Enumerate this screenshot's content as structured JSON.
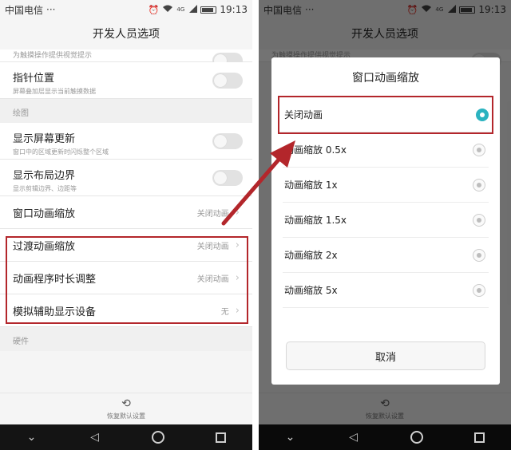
{
  "status": {
    "carrier": "中国电信",
    "dots": "···",
    "network": "4G",
    "time": "19:13"
  },
  "screen_title": "开发人员选项",
  "left_list": {
    "clipped_subtitle": "为触摸操作提供视觉提示",
    "pointer": {
      "title": "指针位置",
      "subtitle": "屏幕叠加层显示当前触摸数据"
    },
    "section_drawing": "绘图",
    "screen_updates": {
      "title": "显示屏幕更新",
      "subtitle": "窗口中的区域更新时闪烁整个区域"
    },
    "layout_bounds": {
      "title": "显示布局边界",
      "subtitle": "显示剪辑边界、边距等"
    },
    "window_anim": {
      "title": "窗口动画缩放",
      "value": "关闭动画"
    },
    "transition_anim": {
      "title": "过渡动画缩放",
      "value": "关闭动画"
    },
    "animator_duration": {
      "title": "动画程序时长调整",
      "value": "关闭动画"
    },
    "simulate_display": {
      "title": "模拟辅助显示设备",
      "value": "无"
    },
    "section_hardware": "硬件"
  },
  "reset_label": "恢复默认设置",
  "dialog": {
    "title": "窗口动画缩放",
    "options": [
      "关闭动画",
      "动画缩放 0.5x",
      "动画缩放 1x",
      "动画缩放 1.5x",
      "动画缩放 2x",
      "动画缩放 5x"
    ],
    "selected_index": 0,
    "cancel": "取消"
  },
  "colors": {
    "accent": "#2bb3c0",
    "highlight": "#b3262b"
  },
  "icons": {
    "reset": "history-icon",
    "back": "back-triangle-icon",
    "home": "home-circle-icon",
    "recents": "recents-square-icon"
  }
}
